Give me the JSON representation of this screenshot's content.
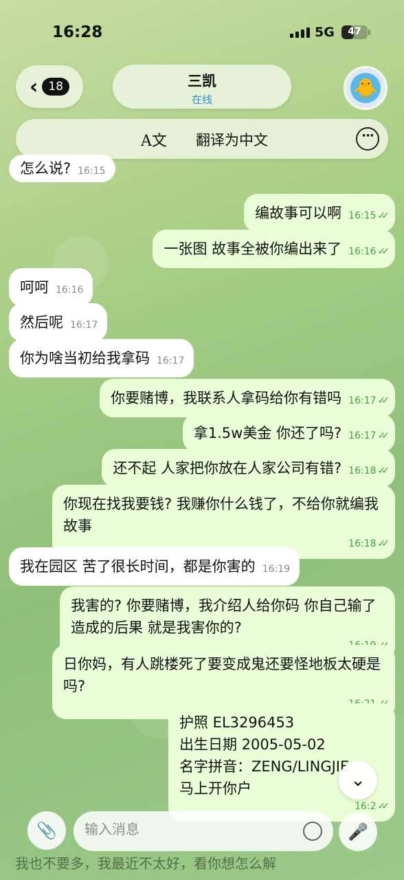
{
  "status_bar": {
    "time": "16:28",
    "network": "5G",
    "battery": "47",
    "battery_level": 0.47
  },
  "header": {
    "back_count": "18",
    "contact_name": "三凯",
    "contact_status": "在线",
    "translate_label": "翻译为中文",
    "translate_icon": "translate-icon",
    "more_icon": "ellipsis-icon"
  },
  "messages": [
    {
      "dir": "in",
      "text": "怎么说?",
      "time": "16:15"
    },
    {
      "dir": "out",
      "text": "编故事可以啊",
      "time": "16:15"
    },
    {
      "dir": "out",
      "text": "一张图 故事全被你编出来了",
      "time": "16:16"
    },
    {
      "dir": "in",
      "text": "呵呵",
      "time": "16:16"
    },
    {
      "dir": "in",
      "text": "然后呢",
      "time": "16:17"
    },
    {
      "dir": "in",
      "text": "你为啥当初给我拿码",
      "time": "16:17"
    },
    {
      "dir": "out",
      "text": "你要赌博，我联系人拿码给你有错吗",
      "time": "16:17"
    },
    {
      "dir": "out",
      "text": "拿1.5w美金 你还了吗?",
      "time": "16:17"
    },
    {
      "dir": "out",
      "text": "还不起 人家把你放在人家公司有错?",
      "time": "16:18"
    },
    {
      "dir": "out",
      "text": "你现在找我要钱? 我赚你什么钱了，不给你就编我故事",
      "time": "16:18"
    },
    {
      "dir": "in",
      "text": "我在园区 苦了很长时间，都是你害的",
      "time": "16:19"
    },
    {
      "dir": "out",
      "text": "我害的? 你要赌博，我介绍人给你码 你自己输了造成的后果 就是我害你的?",
      "time": "16:19"
    },
    {
      "dir": "out",
      "text": "日你妈，有人跳楼死了要变成鬼还要怪地板太硬是吗?",
      "time": "16:21"
    },
    {
      "dir": "out",
      "lines": [
        "护照 EL3296453",
        "出生日期 2005-05-02",
        "名字拼音：ZENG/LINGJIE",
        "马上开你户"
      ],
      "time": "16:2"
    }
  ],
  "composer": {
    "draft_preview": "我也不要多，我最近不太好，看你想怎么解",
    "placeholder": "输入消息",
    "attach_icon": "paperclip-icon",
    "sticker_icon": "sticker-icon",
    "mic_icon": "microphone-icon",
    "scroll_icon": "chevron-down-icon"
  }
}
